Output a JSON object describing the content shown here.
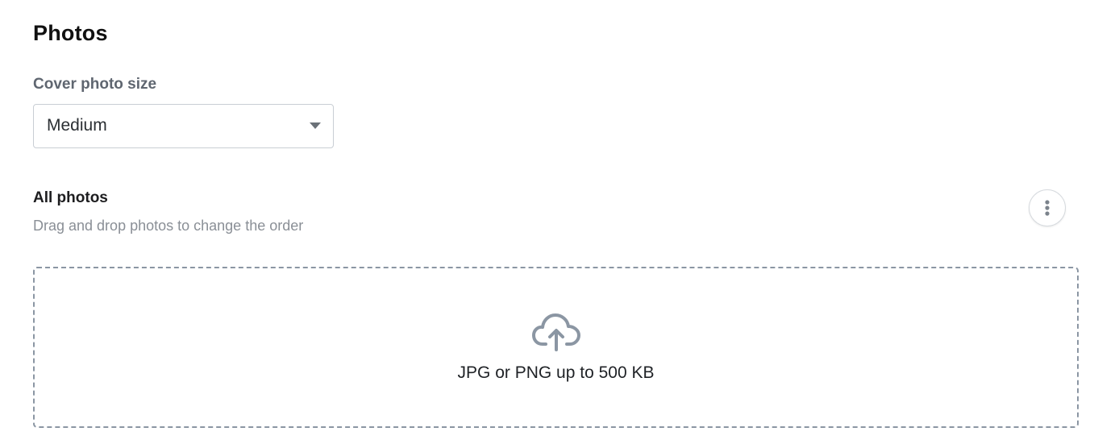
{
  "section": {
    "title": "Photos"
  },
  "cover_photo": {
    "label": "Cover photo size",
    "selected": "Medium"
  },
  "all_photos": {
    "title": "All photos",
    "description": "Drag and drop photos to change the order",
    "more_button_icon": "more-vertical-icon"
  },
  "dropzone": {
    "icon": "cloud-upload-icon",
    "hint": "JPG or PNG up to 500 KB"
  },
  "colors": {
    "border": "#c9ced4",
    "dashed_border": "#8b96a3",
    "icon": "#8b96a3",
    "muted_text": "#8a8f96",
    "label_text": "#5f6670"
  }
}
